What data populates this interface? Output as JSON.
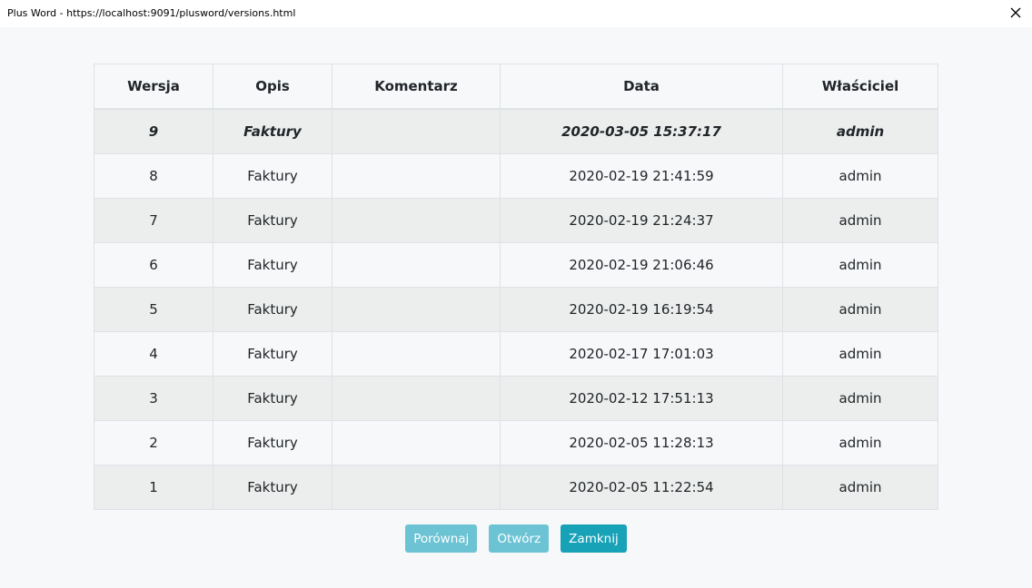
{
  "window": {
    "title": "Plus Word - https://localhost:9091/plusword/versions.html"
  },
  "table": {
    "headers": [
      "Wersja",
      "Opis",
      "Komentarz",
      "Data",
      "Właściciel"
    ],
    "rows": [
      {
        "version": "9",
        "description": "Faktury",
        "comment": "",
        "date": "2020-03-05 15:37:17",
        "owner": "admin"
      },
      {
        "version": "8",
        "description": "Faktury",
        "comment": "",
        "date": "2020-02-19 21:41:59",
        "owner": "admin"
      },
      {
        "version": "7",
        "description": "Faktury",
        "comment": "",
        "date": "2020-02-19 21:24:37",
        "owner": "admin"
      },
      {
        "version": "6",
        "description": "Faktury",
        "comment": "",
        "date": "2020-02-19 21:06:46",
        "owner": "admin"
      },
      {
        "version": "5",
        "description": "Faktury",
        "comment": "",
        "date": "2020-02-19 16:19:54",
        "owner": "admin"
      },
      {
        "version": "4",
        "description": "Faktury",
        "comment": "",
        "date": "2020-02-17 17:01:03",
        "owner": "admin"
      },
      {
        "version": "3",
        "description": "Faktury",
        "comment": "",
        "date": "2020-02-12 17:51:13",
        "owner": "admin"
      },
      {
        "version": "2",
        "description": "Faktury",
        "comment": "",
        "date": "2020-02-05 11:28:13",
        "owner": "admin"
      },
      {
        "version": "1",
        "description": "Faktury",
        "comment": "",
        "date": "2020-02-05 11:22:54",
        "owner": "admin"
      }
    ]
  },
  "buttons": {
    "compare": "Porównaj",
    "open": "Otwórz",
    "close": "Zamknij"
  },
  "icons": {
    "close": "close-icon"
  },
  "colors": {
    "accent": "#17a2b8",
    "accent_light": "#6cc3d4",
    "row_odd": "#eceeed",
    "row_even": "#f7f8fa"
  }
}
